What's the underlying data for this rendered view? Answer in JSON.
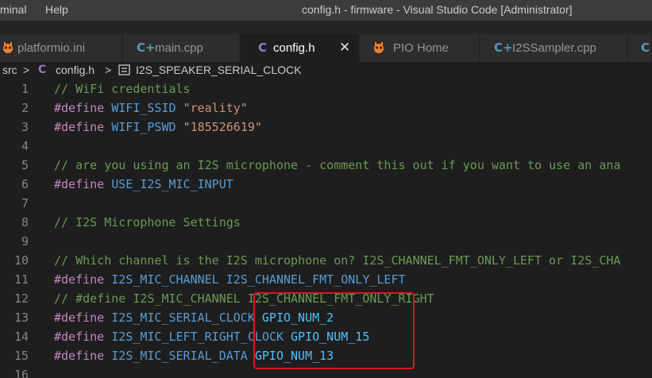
{
  "titlebar": {
    "menu": [
      "minal",
      "Help"
    ],
    "title": "config.h - firmware - Visual Studio Code [Administrator]"
  },
  "tabs": [
    {
      "icon": "platformio-icon",
      "label": "platformio.ini",
      "active": false
    },
    {
      "icon": "cpp-file-icon",
      "glyph": "C+",
      "label": "main.cpp",
      "active": false
    },
    {
      "icon": "c-header-icon",
      "glyph": "C",
      "label": "config.h",
      "active": true,
      "close": "✕"
    },
    {
      "icon": "platformio-icon",
      "label": "PIO Home",
      "active": false
    },
    {
      "icon": "cpp-file-icon",
      "glyph": "C+",
      "label": "I2SSampler.cpp",
      "active": false
    }
  ],
  "breadcrumb": {
    "folder": "src",
    "sep": ">",
    "file_glyph": "C",
    "file": "config.h",
    "symbol": "I2S_SPEAKER_SERIAL_CLOCK"
  },
  "code": {
    "lines": [
      {
        "n": "1",
        "tokens": [
          {
            "c": "cm",
            "t": "// WiFi credentials"
          }
        ]
      },
      {
        "n": "2",
        "tokens": [
          {
            "c": "pp",
            "t": "#define "
          },
          {
            "c": "mc",
            "t": "WIFI_SSID "
          },
          {
            "c": "st",
            "t": "\"reality\""
          }
        ]
      },
      {
        "n": "3",
        "tokens": [
          {
            "c": "pp",
            "t": "#define "
          },
          {
            "c": "mc",
            "t": "WIFI_PSWD "
          },
          {
            "c": "st",
            "t": "\"185526619\""
          }
        ]
      },
      {
        "n": "4",
        "tokens": []
      },
      {
        "n": "5",
        "tokens": [
          {
            "c": "cm",
            "t": "// are you using an I2S microphone - comment this out if you want to use an ana"
          }
        ]
      },
      {
        "n": "6",
        "tokens": [
          {
            "c": "pp",
            "t": "#define "
          },
          {
            "c": "mc",
            "t": "USE_I2S_MIC_INPUT"
          }
        ]
      },
      {
        "n": "7",
        "tokens": []
      },
      {
        "n": "8",
        "tokens": [
          {
            "c": "cm",
            "t": "// I2S Microphone Settings"
          }
        ]
      },
      {
        "n": "9",
        "tokens": []
      },
      {
        "n": "10",
        "tokens": [
          {
            "c": "cm",
            "t": "// Which channel is the I2S microphone on? I2S_CHANNEL_FMT_ONLY_LEFT or I2S_CHA"
          }
        ]
      },
      {
        "n": "11",
        "tokens": [
          {
            "c": "pp",
            "t": "#define "
          },
          {
            "c": "mc",
            "t": "I2S_MIC_CHANNEL "
          },
          {
            "c": "mc",
            "t": "I2S_CHANNEL_FMT_ONLY_LEFT"
          }
        ]
      },
      {
        "n": "12",
        "tokens": [
          {
            "c": "cm",
            "t": "// #define I2S_MIC_CHANNEL I2S_CHANNEL_FMT_ONLY_RIGHT"
          }
        ]
      },
      {
        "n": "13",
        "tokens": [
          {
            "c": "pp",
            "t": "#define "
          },
          {
            "c": "mc",
            "t": "I2S_MIC_SERIAL_CLOCK "
          },
          {
            "c": "id",
            "t": "GPIO_NUM_2"
          }
        ]
      },
      {
        "n": "14",
        "tokens": [
          {
            "c": "pp",
            "t": "#define "
          },
          {
            "c": "mc",
            "t": "I2S_MIC_LEFT_RIGHT_CLOCK "
          },
          {
            "c": "id",
            "t": "GPIO_NUM_15"
          }
        ]
      },
      {
        "n": "15",
        "tokens": [
          {
            "c": "pp",
            "t": "#define "
          },
          {
            "c": "mc",
            "t": "I2S_MIC_SERIAL_DATA "
          },
          {
            "c": "id",
            "t": "GPIO_NUM_13"
          }
        ]
      },
      {
        "n": "16",
        "tokens": []
      }
    ]
  },
  "colors": {
    "comment": "#6a9955",
    "preprocessor": "#c586c0",
    "macro": "#569cd6",
    "string": "#ce9178",
    "identifier": "#4fc1ff",
    "highlight_box": "#e81123"
  }
}
